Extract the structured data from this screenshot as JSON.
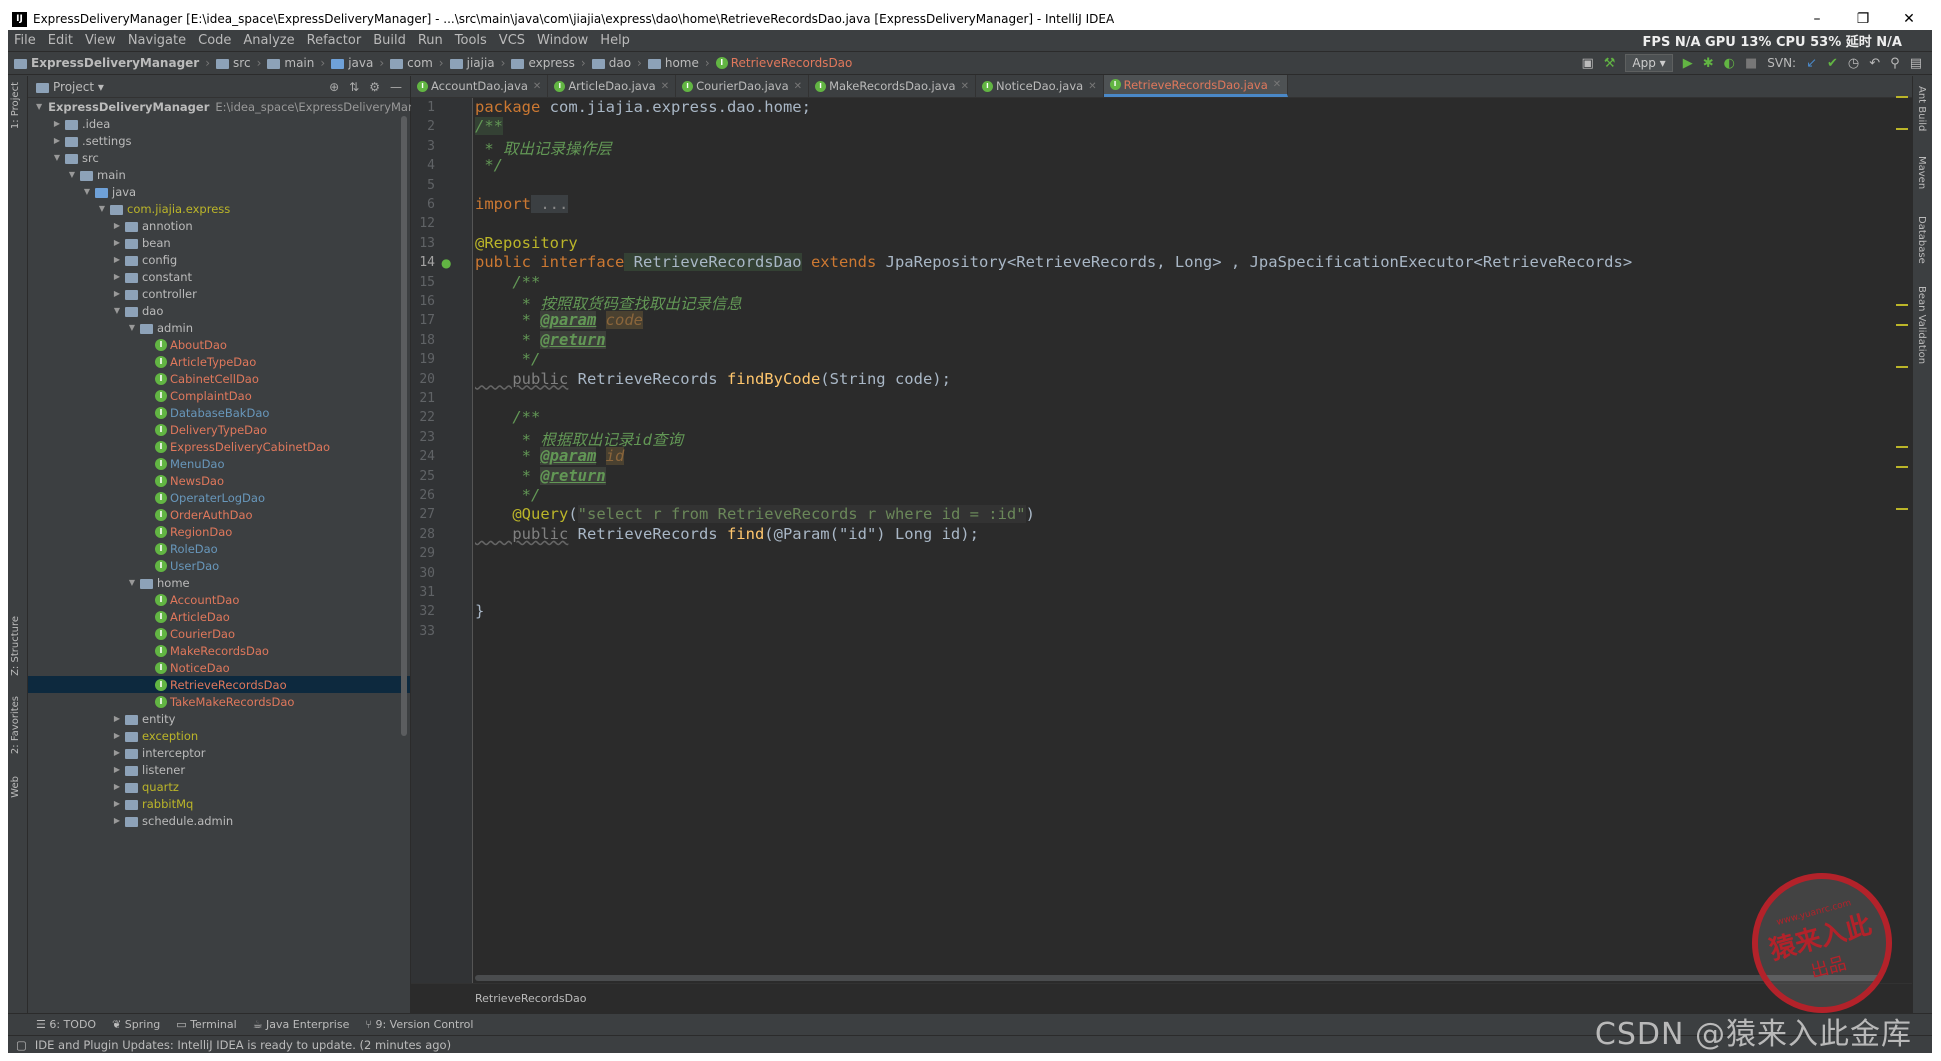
{
  "window": {
    "title": "ExpressDeliveryManager [E:\\idea_space\\ExpressDeliveryManager] - ...\\src\\main\\java\\com\\jiajia\\express\\dao\\home\\RetrieveRecordsDao.java [ExpressDeliveryManager] - IntelliJ IDEA",
    "min": "–",
    "max": "❐",
    "close": "✕"
  },
  "menu": [
    "File",
    "Edit",
    "View",
    "Navigate",
    "Code",
    "Analyze",
    "Refactor",
    "Build",
    "Run",
    "Tools",
    "VCS",
    "Window",
    "Help"
  ],
  "perf": "FPS N/A GPU 13% CPU 53% 延时 N/A",
  "breadcrumbs": [
    "ExpressDeliveryManager",
    "src",
    "main",
    "java",
    "com",
    "jiajia",
    "express",
    "dao",
    "home",
    "RetrieveRecordsDao"
  ],
  "toolbar": {
    "app": "App ▾",
    "svn": "SVN:"
  },
  "project": {
    "header": "Project ▾",
    "rows": [
      {
        "indent": 0,
        "arrow": "▼",
        "icon": "folder",
        "label": "ExpressDeliveryManager",
        "extra": "E:\\idea_space\\ExpressDeliveryManager",
        "bold": true
      },
      {
        "indent": 1,
        "arrow": "▶",
        "icon": "folder",
        "label": ".idea"
      },
      {
        "indent": 1,
        "arrow": "▶",
        "icon": "folder",
        "label": ".settings"
      },
      {
        "indent": 1,
        "arrow": "▼",
        "icon": "folder",
        "label": "src"
      },
      {
        "indent": 2,
        "arrow": "▼",
        "icon": "folder",
        "label": "main"
      },
      {
        "indent": 3,
        "arrow": "▼",
        "icon": "folder-blue",
        "label": "java"
      },
      {
        "indent": 4,
        "arrow": "▼",
        "icon": "folder",
        "label": "com.jiajia.express",
        "color": "olive"
      },
      {
        "indent": 5,
        "arrow": "▶",
        "icon": "folder",
        "label": "annotion"
      },
      {
        "indent": 5,
        "arrow": "▶",
        "icon": "folder",
        "label": "bean"
      },
      {
        "indent": 5,
        "arrow": "▶",
        "icon": "folder",
        "label": "config"
      },
      {
        "indent": 5,
        "arrow": "▶",
        "icon": "folder",
        "label": "constant"
      },
      {
        "indent": 5,
        "arrow": "▶",
        "icon": "folder",
        "label": "controller"
      },
      {
        "indent": 5,
        "arrow": "▼",
        "icon": "folder",
        "label": "dao"
      },
      {
        "indent": 6,
        "arrow": "▼",
        "icon": "folder",
        "label": "admin"
      },
      {
        "indent": 7,
        "arrow": "",
        "icon": "class",
        "label": "AboutDao",
        "color": "red"
      },
      {
        "indent": 7,
        "arrow": "",
        "icon": "class",
        "label": "ArticleTypeDao",
        "color": "red"
      },
      {
        "indent": 7,
        "arrow": "",
        "icon": "class",
        "label": "CabinetCellDao",
        "color": "red"
      },
      {
        "indent": 7,
        "arrow": "",
        "icon": "class",
        "label": "ComplaintDao",
        "color": "red"
      },
      {
        "indent": 7,
        "arrow": "",
        "icon": "class",
        "label": "DatabaseBakDao",
        "color": "blue"
      },
      {
        "indent": 7,
        "arrow": "",
        "icon": "class",
        "label": "DeliveryTypeDao",
        "color": "red"
      },
      {
        "indent": 7,
        "arrow": "",
        "icon": "class",
        "label": "ExpressDeliveryCabinetDao",
        "color": "red"
      },
      {
        "indent": 7,
        "arrow": "",
        "icon": "class",
        "label": "MenuDao",
        "color": "blue"
      },
      {
        "indent": 7,
        "arrow": "",
        "icon": "class",
        "label": "NewsDao",
        "color": "red"
      },
      {
        "indent": 7,
        "arrow": "",
        "icon": "class",
        "label": "OperaterLogDao",
        "color": "blue"
      },
      {
        "indent": 7,
        "arrow": "",
        "icon": "class",
        "label": "OrderAuthDao",
        "color": "red"
      },
      {
        "indent": 7,
        "arrow": "",
        "icon": "class",
        "label": "RegionDao",
        "color": "red"
      },
      {
        "indent": 7,
        "arrow": "",
        "icon": "class",
        "label": "RoleDao",
        "color": "blue"
      },
      {
        "indent": 7,
        "arrow": "",
        "icon": "class",
        "label": "UserDao",
        "color": "blue"
      },
      {
        "indent": 6,
        "arrow": "▼",
        "icon": "folder",
        "label": "home"
      },
      {
        "indent": 7,
        "arrow": "",
        "icon": "class",
        "label": "AccountDao",
        "color": "red"
      },
      {
        "indent": 7,
        "arrow": "",
        "icon": "class",
        "label": "ArticleDao",
        "color": "red"
      },
      {
        "indent": 7,
        "arrow": "",
        "icon": "class",
        "label": "CourierDao",
        "color": "red"
      },
      {
        "indent": 7,
        "arrow": "",
        "icon": "class",
        "label": "MakeRecordsDao",
        "color": "red"
      },
      {
        "indent": 7,
        "arrow": "",
        "icon": "class",
        "label": "NoticeDao",
        "color": "red"
      },
      {
        "indent": 7,
        "arrow": "",
        "icon": "class",
        "label": "RetrieveRecordsDao",
        "color": "red",
        "selected": true
      },
      {
        "indent": 7,
        "arrow": "",
        "icon": "class",
        "label": "TakeMakeRecordsDao",
        "color": "red"
      },
      {
        "indent": 5,
        "arrow": "▶",
        "icon": "folder",
        "label": "entity"
      },
      {
        "indent": 5,
        "arrow": "▶",
        "icon": "folder",
        "label": "exception",
        "color": "olive"
      },
      {
        "indent": 5,
        "arrow": "▶",
        "icon": "folder",
        "label": "interceptor"
      },
      {
        "indent": 5,
        "arrow": "▶",
        "icon": "folder",
        "label": "listener"
      },
      {
        "indent": 5,
        "arrow": "▶",
        "icon": "folder",
        "label": "quartz",
        "color": "olive"
      },
      {
        "indent": 5,
        "arrow": "▶",
        "icon": "folder",
        "label": "rabbitMq",
        "color": "olive"
      },
      {
        "indent": 5,
        "arrow": "▶",
        "icon": "folder",
        "label": "schedule.admin"
      }
    ]
  },
  "tabs": [
    {
      "label": "AccountDao.java"
    },
    {
      "label": "ArticleDao.java"
    },
    {
      "label": "CourierDao.java"
    },
    {
      "label": "MakeRecordsDao.java"
    },
    {
      "label": "NoticeDao.java"
    },
    {
      "label": "RetrieveRecordsDao.java",
      "active": true
    }
  ],
  "code": {
    "lines": [
      "1",
      "2",
      "3",
      "4",
      "5",
      "6",
      "12",
      "13",
      "14",
      "15",
      "16",
      "17",
      "18",
      "19",
      "20",
      "21",
      "22",
      "23",
      "24",
      "25",
      "26",
      "27",
      "28",
      "29",
      "30",
      "31",
      "32",
      "33"
    ],
    "package_kw": "package",
    "package_name": " com.jiajia.express.dao.home;",
    "c2": "/**",
    "c3": " * 取出记录操作层",
    "c4": " */",
    "import_kw": "import",
    "import_fold": " ...",
    "anno_repo": "@Repository",
    "l14_public": "public",
    "l14_interface": " interface",
    "l14_name": " RetrieveRecordsDao",
    "l14_extends": " extends",
    "l14_rest": " JpaRepository<RetrieveRecords, Long> , JpaSpecificationExecutor<RetrieveRecords>",
    "c15": "    /**",
    "c16": "     * 按照取货码查找取出记录信息",
    "c17_star": "     * ",
    "c17_tag": "@param",
    "c17_name": "code",
    "c18_star": "     * ",
    "c18_tag": "@return",
    "c19": "     */",
    "l20_pub": "    public",
    "l20_type": " RetrieveRecords ",
    "l20_fn": "findByCode",
    "l20_rest": "(String code);",
    "c22": "    /**",
    "c23": "     * 根据取出记录id查询",
    "c24_star": "     * ",
    "c24_tag": "@param",
    "c24_name": "id",
    "c25_star": "     * ",
    "c25_tag": "@return",
    "c26": "     */",
    "l27_anno": "    @Query",
    "l27_open": "(",
    "l27_str": "\"select r from RetrieveRecords r where id = :id\"",
    "l27_close": ")",
    "l28_pub": "    public",
    "l28_type": " RetrieveRecords ",
    "l28_fn": "find",
    "l28_rest": "(@Param(\"id\") Long id);",
    "l32": "}"
  },
  "editor_breadcrumb": "RetrieveRecordsDao",
  "left_tabs": [
    "1: Project",
    "Z: Structure",
    "2: Favorites",
    "Web"
  ],
  "right_tabs": [
    "Ant Build",
    "Maven",
    "Database",
    "Bean Validation"
  ],
  "bottom_tabs": [
    "6: TODO",
    "Spring",
    "Terminal",
    "Java Enterprise",
    "9: Version Control"
  ],
  "status": "IDE and Plugin Updates: IntelliJ IDEA is ready to update. (2 minutes ago)",
  "watermark": "CSDN @猿来入此金库",
  "stamp": {
    "line1": "猿来入此",
    "line2": "出品",
    "url": "www.yuanrc.com"
  }
}
